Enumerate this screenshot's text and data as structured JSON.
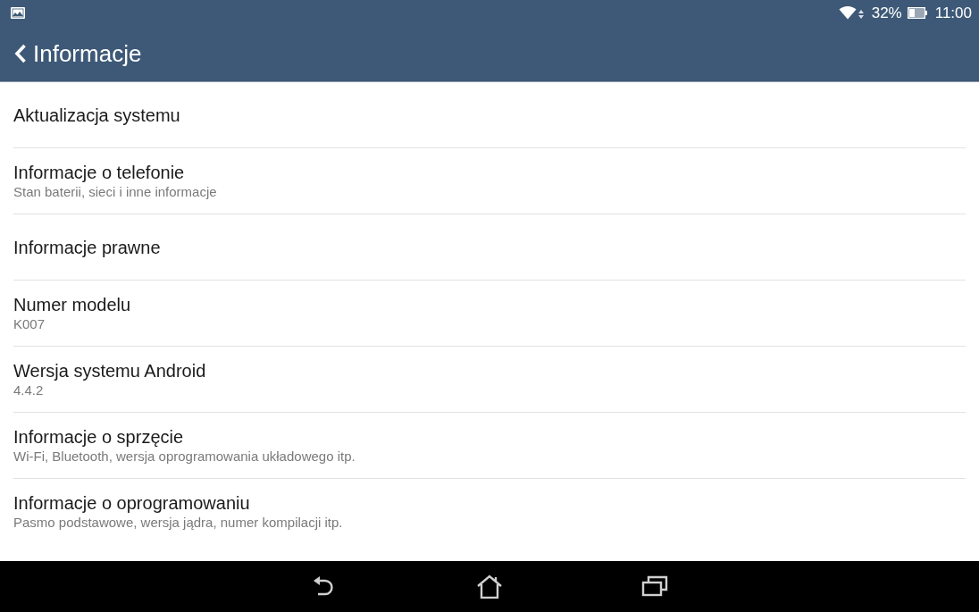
{
  "status_bar": {
    "battery": "32%",
    "time": "11:00"
  },
  "action_bar": {
    "title": "Informacje"
  },
  "items": [
    {
      "title": "Aktualizacja systemu"
    },
    {
      "title": "Informacje o telefonie",
      "summary": "Stan baterii, sieci i inne informacje"
    },
    {
      "title": "Informacje prawne"
    },
    {
      "title": "Numer modelu",
      "summary": "K007"
    },
    {
      "title": "Wersja systemu Android",
      "summary": "4.4.2"
    },
    {
      "title": "Informacje o sprzęcie",
      "summary": "Wi-Fi, Bluetooth, wersja oprogramowania układowego itp."
    },
    {
      "title": "Informacje o oprogramowaniu",
      "summary": "Pasmo podstawowe, wersja jądra, numer kompilacji itp."
    }
  ]
}
